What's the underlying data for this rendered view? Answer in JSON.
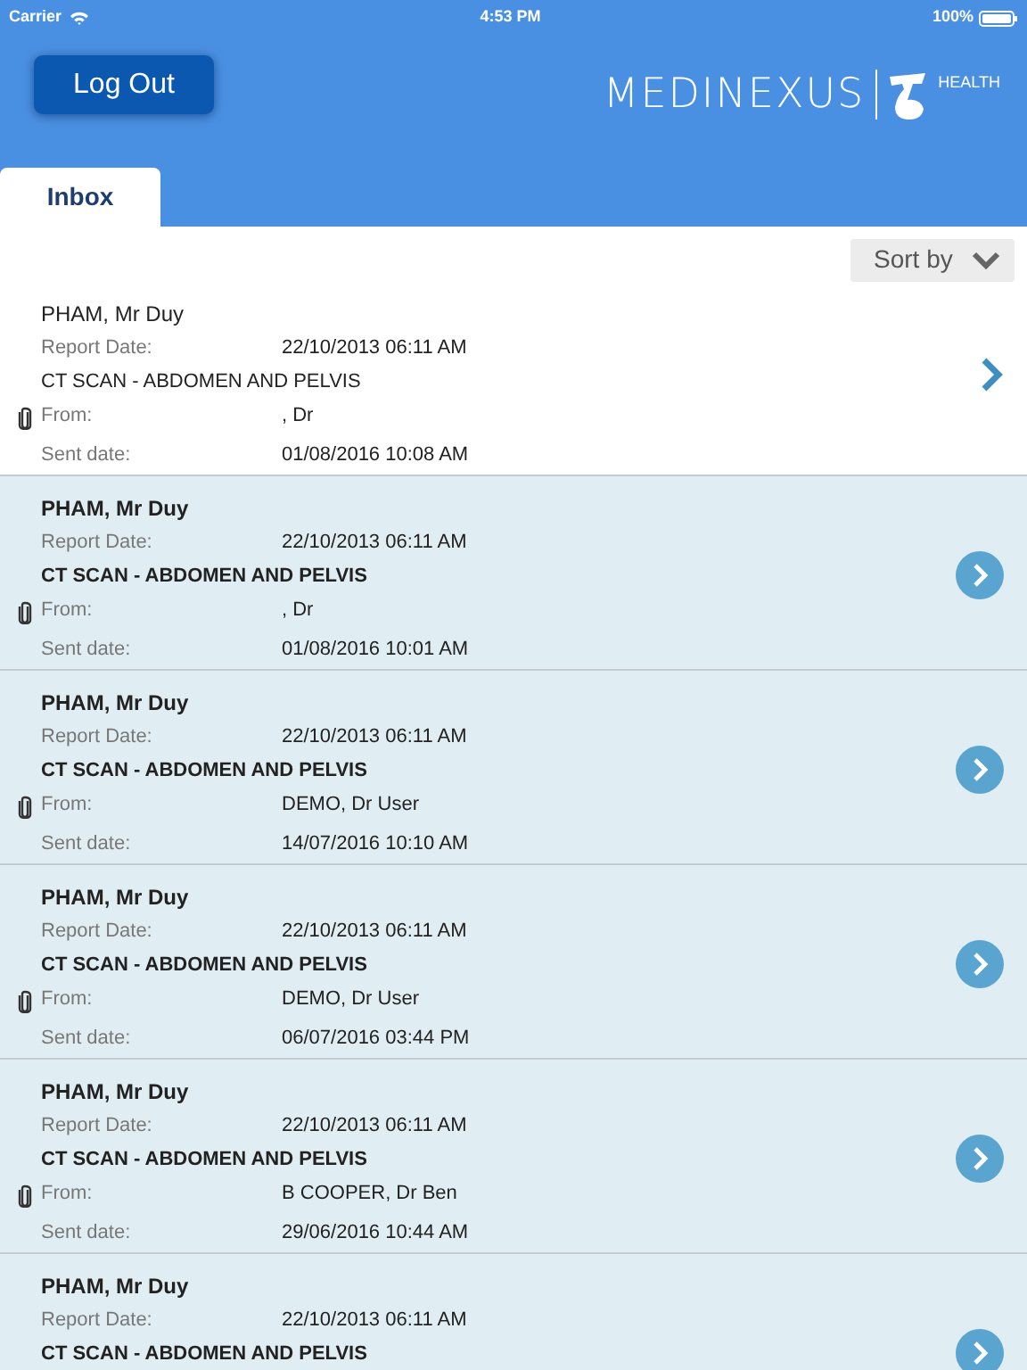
{
  "status_bar": {
    "carrier": "Carrier",
    "time": "4:53 PM",
    "battery": "100%"
  },
  "header": {
    "logout_button": "Log Out",
    "logo_text": "MEDINEXUS",
    "logo_sub": "HEALTH"
  },
  "tabs": [
    {
      "label": "Inbox",
      "selected": true
    }
  ],
  "sort_button": "Sort by",
  "messages": [
    {
      "patient": "PHAM, Mr Duy",
      "unread": false,
      "report_date_label": "Report Date:",
      "report_date": "22/10/2013 06:11 AM",
      "study": "CT SCAN - ABDOMEN AND PELVIS",
      "attachment": true,
      "from_label": "From:",
      "from": ", Dr",
      "sent_label": "Sent date:",
      "sent": "01/08/2016 10:08 AM"
    },
    {
      "patient": "PHAM, Mr Duy",
      "unread": true,
      "report_date_label": "Report Date:",
      "report_date": "22/10/2013 06:11 AM",
      "study": "CT SCAN - ABDOMEN AND PELVIS",
      "attachment": true,
      "from_label": "From:",
      "from": ", Dr",
      "sent_label": "Sent date:",
      "sent": "01/08/2016 10:01 AM"
    },
    {
      "patient": "PHAM, Mr Duy",
      "unread": true,
      "report_date_label": "Report Date:",
      "report_date": "22/10/2013 06:11 AM",
      "study": "CT SCAN - ABDOMEN AND PELVIS",
      "attachment": true,
      "from_label": "From:",
      "from": "DEMO, Dr User",
      "sent_label": "Sent date:",
      "sent": "14/07/2016 10:10 AM"
    },
    {
      "patient": "PHAM, Mr Duy",
      "unread": true,
      "report_date_label": "Report Date:",
      "report_date": "22/10/2013 06:11 AM",
      "study": "CT SCAN - ABDOMEN AND PELVIS",
      "attachment": true,
      "from_label": "From:",
      "from": "DEMO, Dr User",
      "sent_label": "Sent date:",
      "sent": "06/07/2016 03:44 PM"
    },
    {
      "patient": "PHAM, Mr Duy",
      "unread": true,
      "report_date_label": "Report Date:",
      "report_date": "22/10/2013 06:11 AM",
      "study": "CT SCAN - ABDOMEN AND PELVIS",
      "attachment": true,
      "from_label": "From:",
      "from": "B COOPER, Dr Ben",
      "sent_label": "Sent date:",
      "sent": "29/06/2016 10:44 AM"
    },
    {
      "patient": "PHAM, Mr Duy",
      "unread": true,
      "report_date_label": "Report Date:",
      "report_date": "22/10/2013 06:11 AM",
      "study": "CT SCAN - ABDOMEN AND PELVIS"
    }
  ]
}
